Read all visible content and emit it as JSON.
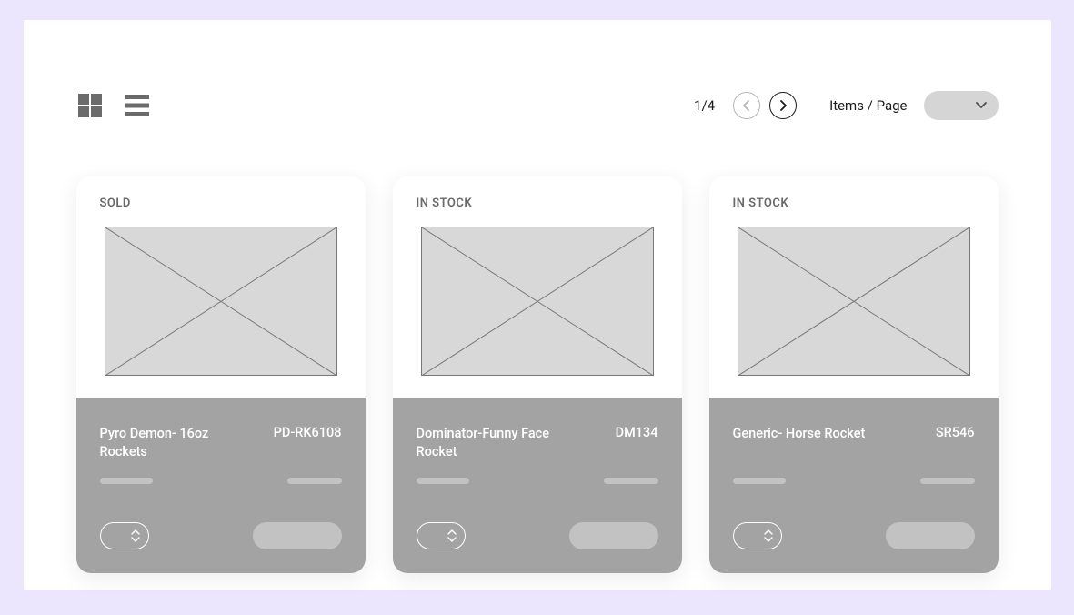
{
  "pagination": {
    "current": 1,
    "total": 4,
    "indicator": "1/4"
  },
  "items_per_page_label": "Items / Page",
  "products": [
    {
      "status": "SOLD",
      "name": "Pyro Demon- 16oz Rockets",
      "sku": "PD-RK6108"
    },
    {
      "status": "IN STOCK",
      "name": "Dominator-Funny Face Rocket",
      "sku": "DM134"
    },
    {
      "status": "IN STOCK",
      "name": "Generic- Horse Rocket",
      "sku": "SR546"
    }
  ]
}
